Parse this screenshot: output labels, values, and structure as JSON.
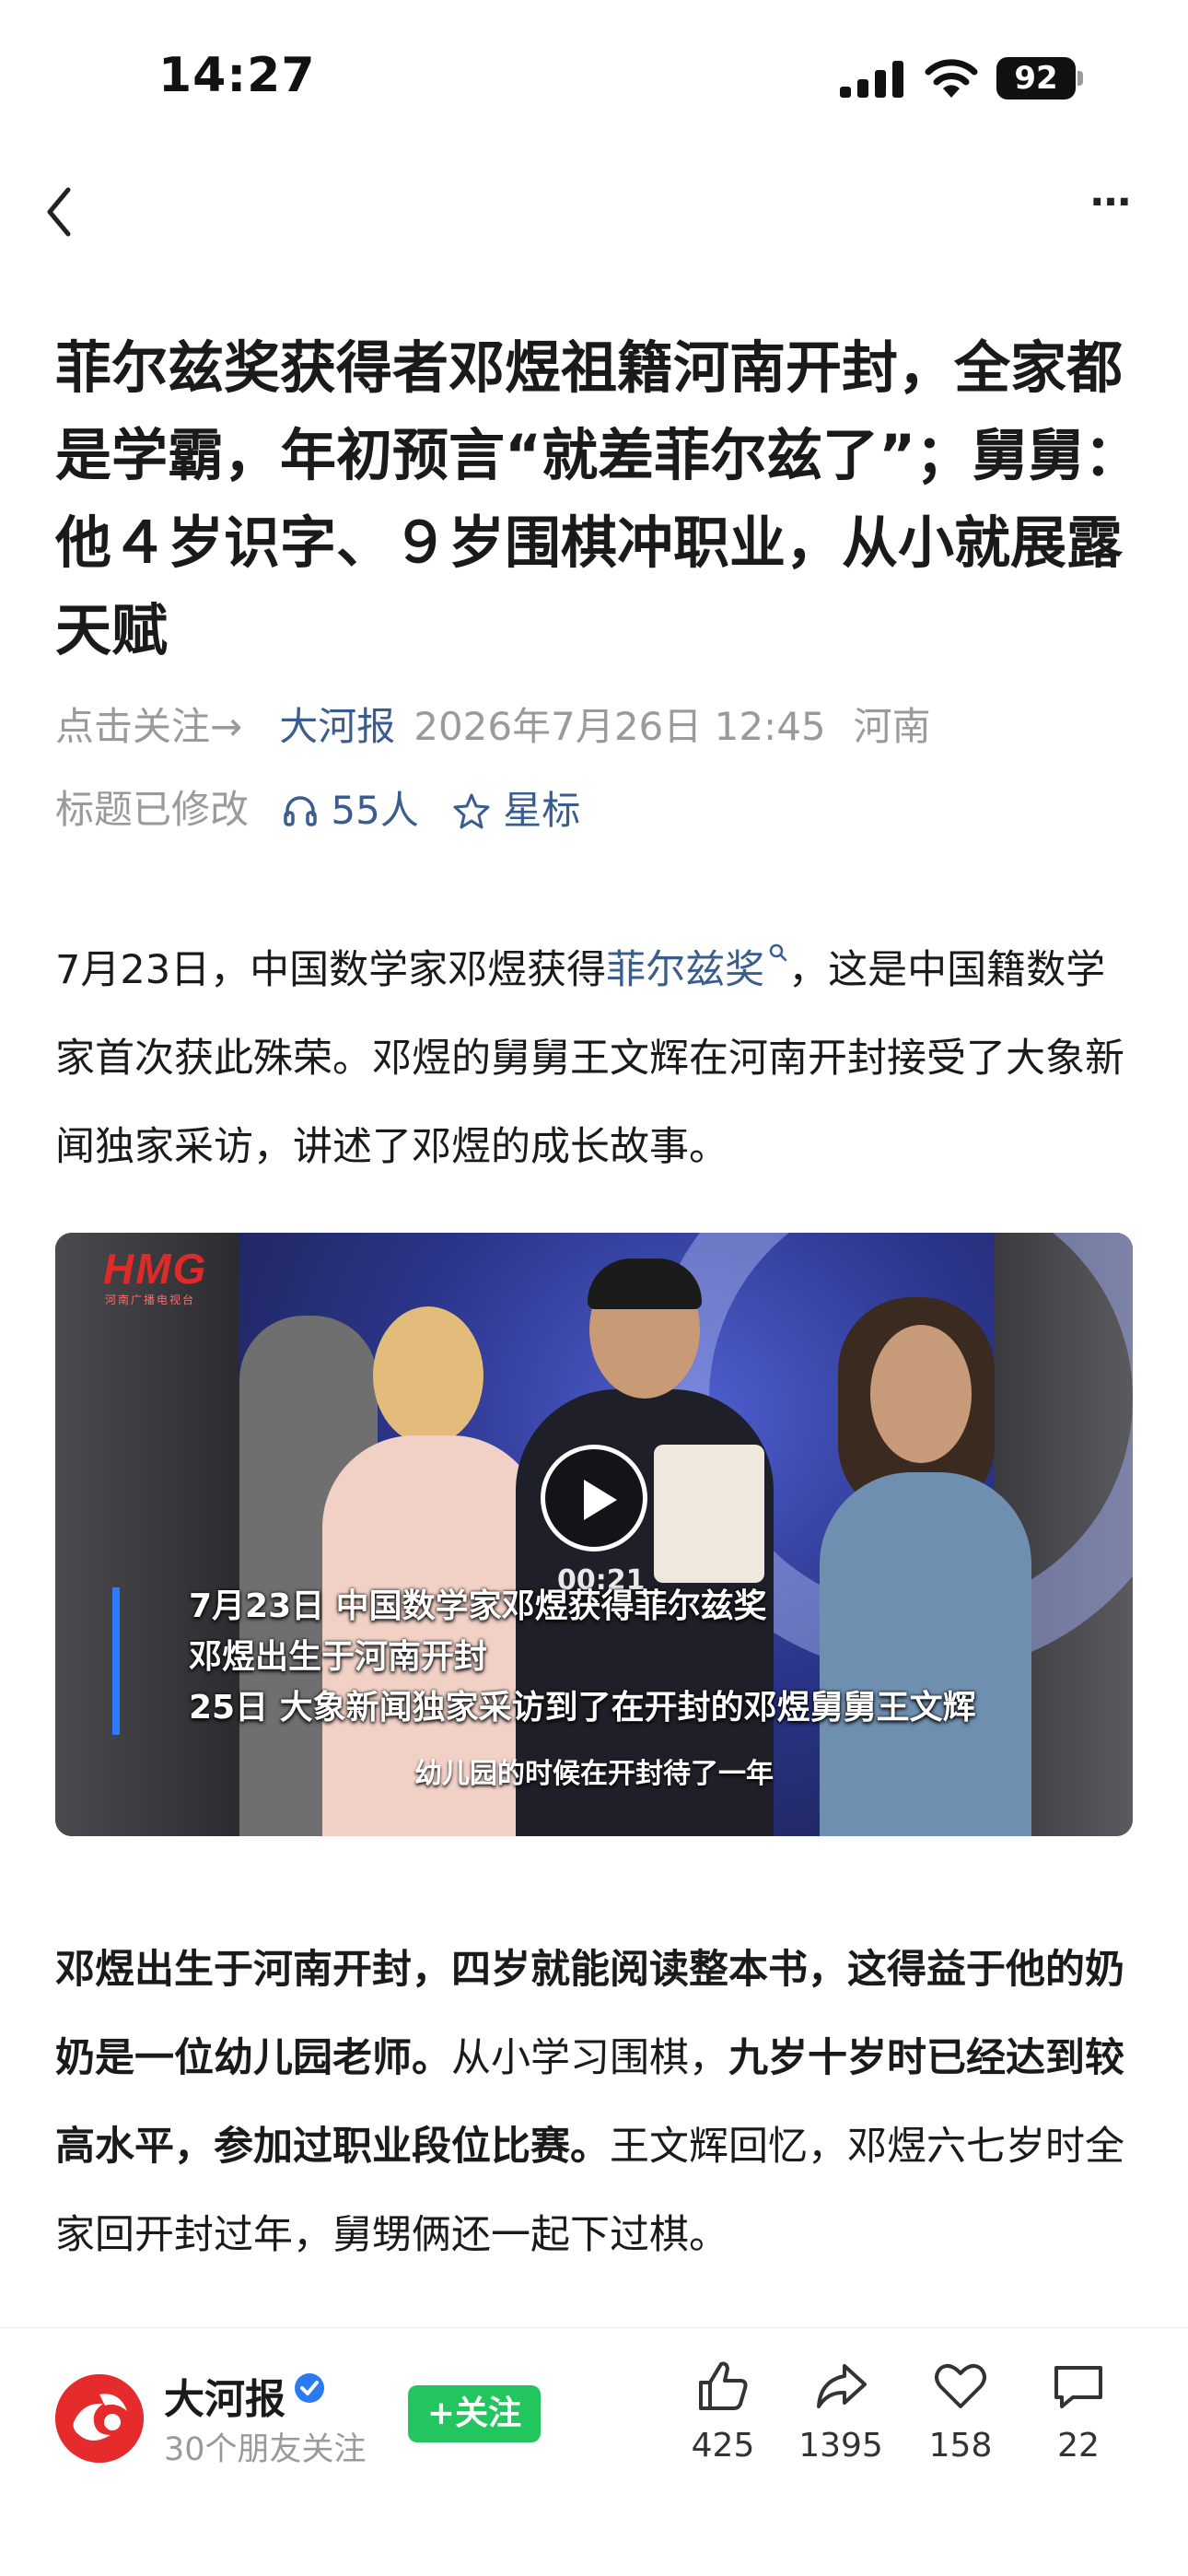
{
  "status_bar": {
    "time": "14:27",
    "battery": "92",
    "icons": [
      "signal-icon",
      "wifi-icon",
      "battery-icon"
    ]
  },
  "nav": {
    "back_icon": "chevron-left-icon",
    "more_label": "···"
  },
  "article": {
    "title": "菲尔兹奖获得者邓煜祖籍河南开封，全家都是学霸，年初预言“就差菲尔兹了”；舅舅：他４岁识字、９岁围棋冲职业，从小就展露天赋",
    "meta": {
      "follow_prompt": "点击关注→",
      "publisher": "大河报",
      "date": "2026年7月26日 12:45",
      "location": "河南",
      "edited_note": "标题已修改",
      "listeners": "55人",
      "star_label": "星标"
    },
    "para1": {
      "before": "7月23日，中国数学家邓煜获得",
      "link": "菲尔兹奖",
      "after": "，这是中国籍数学家首次获此殊荣。邓煜的舅舅王文辉在河南开封接受了大象新闻独家采访，讲述了邓煜的成长故事。"
    },
    "video": {
      "logo": "HMG",
      "logo_sub": "河南广播电视台",
      "caption_lines": [
        "7月23日 中国数学家邓煜获得菲尔兹奖",
        "邓煜出生于河南开封",
        "25日 大象新闻独家采访到了在开封的邓煜舅舅王文辉"
      ],
      "duration": "00:21",
      "subtitle": "幼儿园的时候在开封待了一年"
    },
    "para2": {
      "bold1": "邓煜出生于河南开封，四岁就能阅读整本书，这得益于他的奶奶是一位幼儿园老师。",
      "normal1": "从小学习围棋，",
      "bold2": "九岁十岁时已经达到较高水平，参加过职业段位比赛。",
      "normal2": "王文辉回忆，邓煜六七岁时全家回开封过年，舅甥俩还一起下过棋。"
    }
  },
  "bottom_bar": {
    "publisher_name": "大河报",
    "follower_text": "30个朋友关注",
    "follow_label": "+关注",
    "likes": "425",
    "shares": "1395",
    "favorites": "158",
    "comments": "22"
  },
  "colors": {
    "link": "#3a5d8f",
    "follow_green": "#22c55e",
    "brand_red": "#e52b2b",
    "verified_blue": "#2b7bf0"
  }
}
